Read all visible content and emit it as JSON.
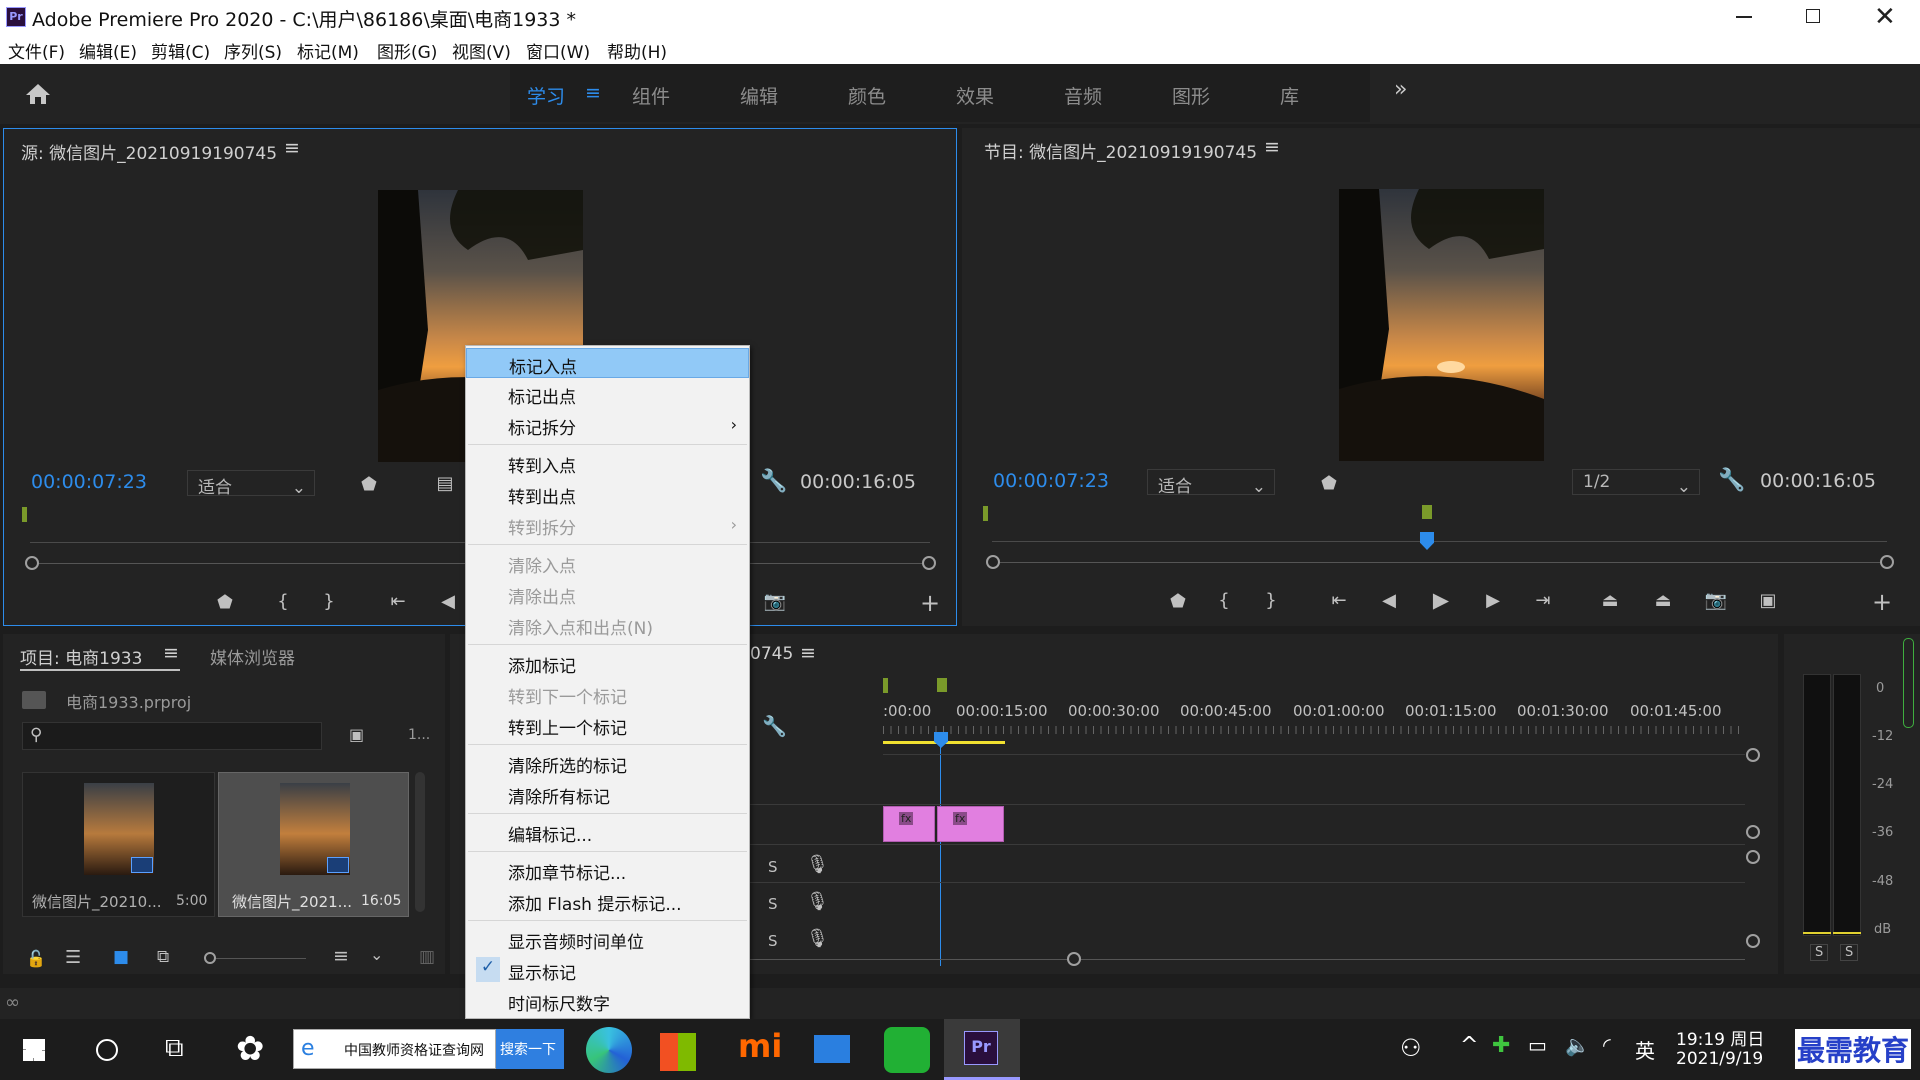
{
  "title": {
    "app_icon": "Pr",
    "text": "Adobe Premiere Pro 2020 - C:\\用户\\86186\\桌面\\电商1933 *"
  },
  "menu": [
    "文件(F)",
    "编辑(E)",
    "剪辑(C)",
    "序列(S)",
    "标记(M)",
    "图形(G)",
    "视图(V)",
    "窗口(W)",
    "帮助(H)"
  ],
  "workspaces": {
    "active": "学习",
    "tabs": [
      "组件",
      "编辑",
      "颜色",
      "效果",
      "音频",
      "图形",
      "库"
    ],
    "more": "»"
  },
  "source": {
    "title": "源: 微信图片_20210919190745",
    "timecode": "00:00:07:23",
    "fit": "适合",
    "duration": "00:00:16:05"
  },
  "program": {
    "title": "节目: 微信图片_20210919190745",
    "timecode": "00:00:07:23",
    "fit": "适合",
    "resolution": "1/2",
    "duration": "00:00:16:05"
  },
  "project": {
    "title": "项目: 电商1933",
    "tab2": "媒体浏览器",
    "file": "电商1933.prproj",
    "count": "1...",
    "items": [
      {
        "name": "微信图片_20210...",
        "duration": "5:00"
      },
      {
        "name": "微信图片_2021...",
        "duration": "16:05"
      }
    ]
  },
  "timeline": {
    "title_suffix": "0745",
    "ticks": [
      ":00:00",
      "00:00:15:00",
      "00:00:30:00",
      "00:00:45:00",
      "00:01:00:00",
      "00:01:15:00",
      "00:01:30:00",
      "00:01:45:00"
    ],
    "clip_fx": "fx",
    "track_s": "S"
  },
  "meter": {
    "labels": [
      "0",
      "-12",
      "-24",
      "-36",
      "-48",
      "dB"
    ],
    "solo": "S"
  },
  "context_menu": [
    {
      "label": "标记入点",
      "state": "highlighted"
    },
    {
      "label": "标记出点"
    },
    {
      "label": "标记拆分",
      "submenu": true
    },
    {
      "sep": true
    },
    {
      "label": "转到入点"
    },
    {
      "label": "转到出点"
    },
    {
      "label": "转到拆分",
      "disabled": true,
      "submenu": true
    },
    {
      "sep": true
    },
    {
      "label": "清除入点",
      "disabled": true
    },
    {
      "label": "清除出点",
      "disabled": true
    },
    {
      "label": "清除入点和出点(N)",
      "disabled": true
    },
    {
      "sep": true
    },
    {
      "label": "添加标记"
    },
    {
      "label": "转到下一个标记",
      "disabled": true
    },
    {
      "label": "转到上一个标记"
    },
    {
      "sep": true
    },
    {
      "label": "清除所选的标记"
    },
    {
      "label": "清除所有标记"
    },
    {
      "sep": true
    },
    {
      "label": "编辑标记..."
    },
    {
      "sep": true
    },
    {
      "label": "添加章节标记..."
    },
    {
      "label": "添加 Flash 提示标记..."
    },
    {
      "sep": true
    },
    {
      "label": "显示音频时间单位"
    },
    {
      "label": "显示标记",
      "checked": true
    },
    {
      "label": "时间标尺数字"
    }
  ],
  "taskbar": {
    "search_text": "中国教师资格证查询网",
    "search_btn": "搜索一下",
    "ime": "英",
    "time": "19:19 周日",
    "date": "2021/9/19",
    "watermark": "最需教育"
  },
  "colors": {
    "accent": "#2d8ceb",
    "clip": "#e17fe0",
    "in_out": "#f0e030",
    "marker": "#7a9a2a"
  }
}
